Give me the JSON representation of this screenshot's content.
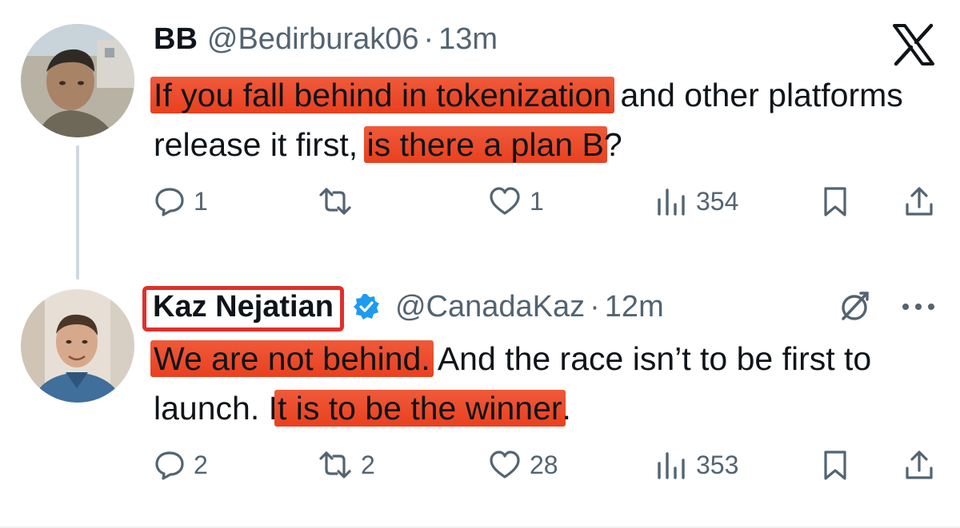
{
  "tweet1": {
    "name": "BB",
    "handle": "@Bedirburak06",
    "separator": "·",
    "time": "13m",
    "text_hl1": "If you fall behind in tokenization",
    "text_plain1": " and other platforms release it first, ",
    "text_hl2": "is there a plan B",
    "text_plain2": "?",
    "replies": "1",
    "reposts": "",
    "likes": "1",
    "views": "354"
  },
  "tweet2": {
    "name": "Kaz Nejatian",
    "handle": "@CanadaKaz",
    "separator": "·",
    "time": "12m",
    "text_hl1": "We are not behind.",
    "text_plain1": "  And the race isn’t to be first to launch. I",
    "text_hl2": "t is to be the winner",
    "text_plain2": ".",
    "replies": "2",
    "reposts": "2",
    "likes": "28",
    "views": "353"
  },
  "colors": {
    "highlight": "#ea4a2a",
    "name_box": "#e0302a",
    "verified": "#1d9bf0",
    "muted": "#536471"
  },
  "icons": [
    "x-logo-icon",
    "reply-icon",
    "repost-icon",
    "like-icon",
    "views-icon",
    "bookmark-icon",
    "share-icon",
    "grok-icon",
    "more-icon",
    "verified-icon"
  ]
}
